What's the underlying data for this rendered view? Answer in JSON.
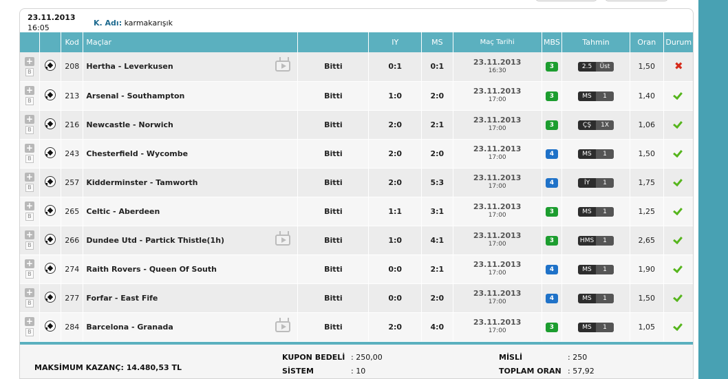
{
  "coupon": {
    "date": "23.11.2013",
    "time": "16:05",
    "user_label": "K. Adı:",
    "user_name": "karmakarışık"
  },
  "headers": {
    "kod": "Kod",
    "maclar": "Maçlar",
    "iy": "IY",
    "ms": "MS",
    "mac_tarihi": "Maç Tarihi",
    "mbs": "MBS",
    "tahmin": "Tahmin",
    "oran": "Oran",
    "durum": "Durum"
  },
  "icons": {
    "add": "plus-icon",
    "b": "B",
    "ball": "soccer-ball-icon",
    "tv": "tv-icon",
    "won": "check-icon",
    "lost": "cross-icon"
  },
  "rows": [
    {
      "kod": "208",
      "match": "Hertha - Leverkusen",
      "tv": true,
      "status": "Bitti",
      "iy": "0:1",
      "ms": "0:1",
      "date": "23.11.2013",
      "time": "16:30",
      "mbs": "3",
      "mbs_color": "green",
      "pred_type": "2.5",
      "pred_val": "Üst",
      "oran": "1,50",
      "result": "lost"
    },
    {
      "kod": "213",
      "match": "Arsenal - Southampton",
      "tv": false,
      "status": "Bitti",
      "iy": "1:0",
      "ms": "2:0",
      "date": "23.11.2013",
      "time": "17:00",
      "mbs": "3",
      "mbs_color": "green",
      "pred_type": "MS",
      "pred_val": "1",
      "oran": "1,40",
      "result": "won"
    },
    {
      "kod": "216",
      "match": "Newcastle - Norwich",
      "tv": false,
      "status": "Bitti",
      "iy": "2:0",
      "ms": "2:1",
      "date": "23.11.2013",
      "time": "17:00",
      "mbs": "3",
      "mbs_color": "green",
      "pred_type": "ÇŞ",
      "pred_val": "1X",
      "oran": "1,06",
      "result": "won"
    },
    {
      "kod": "243",
      "match": "Chesterfield - Wycombe",
      "tv": false,
      "status": "Bitti",
      "iy": "2:0",
      "ms": "2:0",
      "date": "23.11.2013",
      "time": "17:00",
      "mbs": "4",
      "mbs_color": "blue",
      "pred_type": "MS",
      "pred_val": "1",
      "oran": "1,50",
      "result": "won"
    },
    {
      "kod": "257",
      "match": "Kidderminster - Tamworth",
      "tv": false,
      "status": "Bitti",
      "iy": "2:0",
      "ms": "5:3",
      "date": "23.11.2013",
      "time": "17:00",
      "mbs": "4",
      "mbs_color": "blue",
      "pred_type": "İY",
      "pred_val": "1",
      "oran": "1,75",
      "result": "won"
    },
    {
      "kod": "265",
      "match": "Celtic - Aberdeen",
      "tv": false,
      "status": "Bitti",
      "iy": "1:1",
      "ms": "3:1",
      "date": "23.11.2013",
      "time": "17:00",
      "mbs": "3",
      "mbs_color": "green",
      "pred_type": "MS",
      "pred_val": "1",
      "oran": "1,25",
      "result": "won"
    },
    {
      "kod": "266",
      "match": "Dundee Utd - Partick Thistle(1h)",
      "tv": true,
      "status": "Bitti",
      "iy": "1:0",
      "ms": "4:1",
      "date": "23.11.2013",
      "time": "17:00",
      "mbs": "3",
      "mbs_color": "green",
      "pred_type": "HMS",
      "pred_val": "1",
      "oran": "2,65",
      "result": "won"
    },
    {
      "kod": "274",
      "match": "Raith Rovers - Queen Of South",
      "tv": false,
      "status": "Bitti",
      "iy": "0:0",
      "ms": "2:1",
      "date": "23.11.2013",
      "time": "17:00",
      "mbs": "4",
      "mbs_color": "blue",
      "pred_type": "MS",
      "pred_val": "1",
      "oran": "1,90",
      "result": "won"
    },
    {
      "kod": "277",
      "match": "Forfar - East Fife",
      "tv": false,
      "status": "Bitti",
      "iy": "0:0",
      "ms": "2:0",
      "date": "23.11.2013",
      "time": "17:00",
      "mbs": "4",
      "mbs_color": "blue",
      "pred_type": "MS",
      "pred_val": "1",
      "oran": "1,50",
      "result": "won"
    },
    {
      "kod": "284",
      "match": "Barcelona - Granada",
      "tv": true,
      "status": "Bitti",
      "iy": "2:0",
      "ms": "4:0",
      "date": "23.11.2013",
      "time": "17:00",
      "mbs": "3",
      "mbs_color": "green",
      "pred_type": "MS",
      "pred_val": "1",
      "oran": "1,05",
      "result": "won"
    }
  ],
  "footer": {
    "max_label": "MAKSİMUM KAZANÇ:",
    "max_value": "14.480,53 TL",
    "kupon_label": "KUPON BEDELİ",
    "kupon_value": ": 250,00",
    "sistem_label": "SİSTEM",
    "sistem_value": ": 10",
    "misli_label": "MİSLİ",
    "misli_value": ": 250",
    "toplam_label": "TOPLAM ORAN",
    "toplam_value": ": 57,92"
  }
}
